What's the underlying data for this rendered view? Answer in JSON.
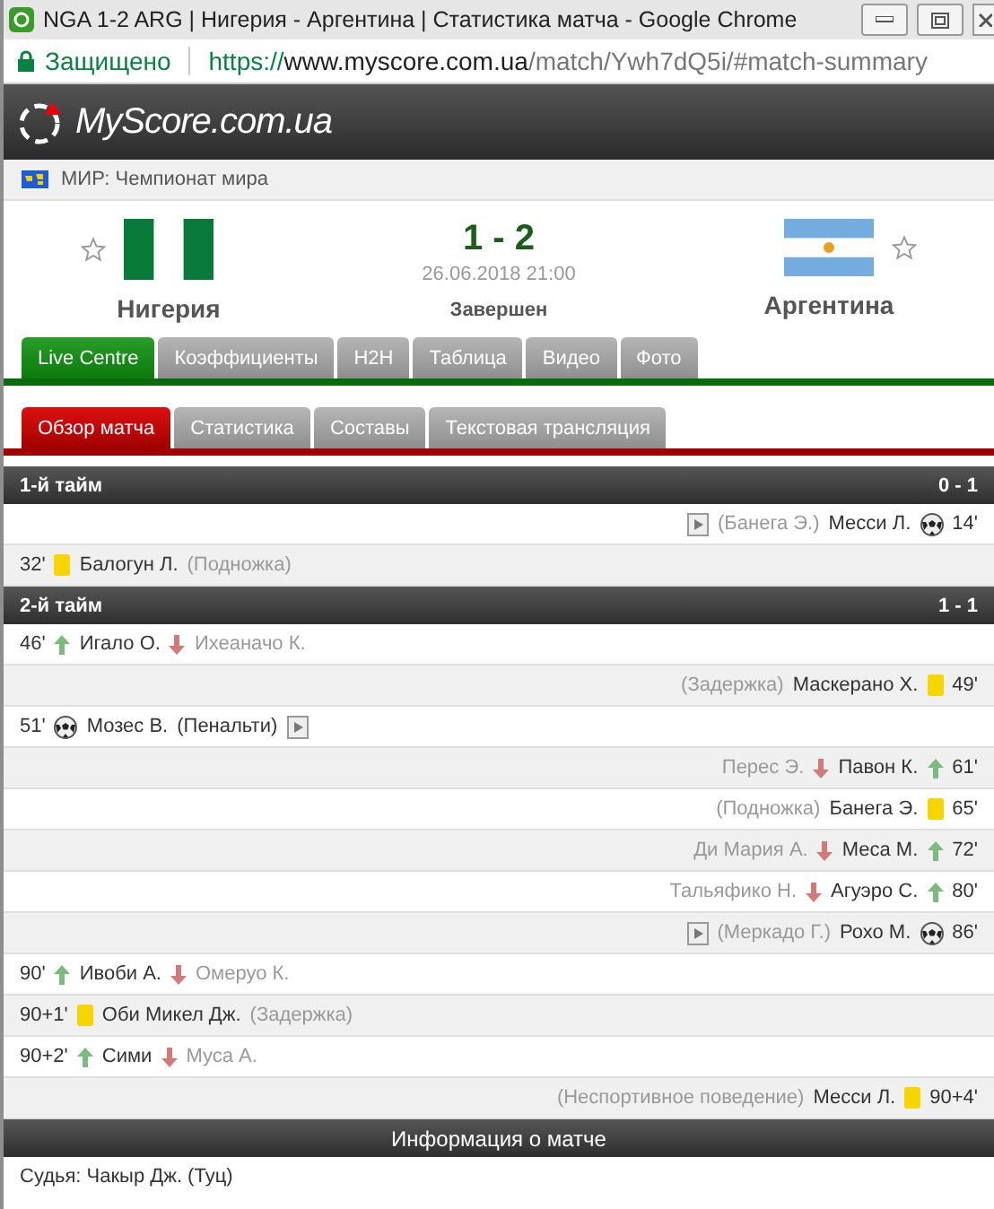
{
  "window": {
    "title": "NGA 1-2 ARG | Нигерия - Аргентина | Статистика матча - Google Chrome"
  },
  "address_bar": {
    "secure_label": "Защищено",
    "url_scheme": "https://",
    "url_host": "www.myscore.com.ua",
    "url_path": "/match/Ywh7dQ5i/#match-summary"
  },
  "site": {
    "logo": "MyScore.com.ua"
  },
  "competition": "МИР: Чемпионат мира",
  "match": {
    "home": "Нигерия",
    "away": "Аргентина",
    "score": "1 - 2",
    "date": "26.06.2018 21:00",
    "status": "Завершен",
    "home_favorite": false,
    "away_favorite": false
  },
  "tabs": [
    {
      "label": "Live Centre",
      "selected": true
    },
    {
      "label": "Коэффициенты",
      "selected": false
    },
    {
      "label": "H2H",
      "selected": false
    },
    {
      "label": "Таблица",
      "selected": false
    },
    {
      "label": "Видео",
      "selected": false
    },
    {
      "label": "Фото",
      "selected": false
    }
  ],
  "subtabs": [
    {
      "label": "Обзор матча",
      "selected": true
    },
    {
      "label": "Статистика",
      "selected": false
    },
    {
      "label": "Составы",
      "selected": false
    },
    {
      "label": "Текстовая трансляция",
      "selected": false
    }
  ],
  "periods": [
    {
      "title": "1-й тайм",
      "score": "0 - 1",
      "events": [
        {
          "away": true,
          "kind": "goal",
          "time": "14'",
          "player": "Месси Л.",
          "note": "(Банега Э.)",
          "note_muted": true,
          "video": true
        },
        {
          "away": false,
          "kind": "card",
          "time": "32'",
          "player": "Балогун Л.",
          "note": "(Подножка)",
          "note_muted": true,
          "video": false
        }
      ]
    },
    {
      "title": "2-й тайм",
      "score": "1 - 1",
      "events": [
        {
          "away": false,
          "kind": "sub",
          "time": "46'",
          "player": "Игало О.",
          "note": "Ихеаначо К.",
          "note_muted": true,
          "video": false
        },
        {
          "away": true,
          "kind": "card",
          "time": "49'",
          "player": "Маскерано Х.",
          "note": "(Задержка)",
          "note_muted": true,
          "video": false
        },
        {
          "away": false,
          "kind": "goal",
          "time": "51'",
          "player": "Мозес В.",
          "note": "(Пенальти)",
          "note_muted": false,
          "video": true
        },
        {
          "away": true,
          "kind": "sub",
          "time": "61'",
          "player": "Павон К.",
          "note": "Перес Э.",
          "note_muted": true,
          "video": false
        },
        {
          "away": true,
          "kind": "card",
          "time": "65'",
          "player": "Банега Э.",
          "note": "(Подножка)",
          "note_muted": true,
          "video": false
        },
        {
          "away": true,
          "kind": "sub",
          "time": "72'",
          "player": "Меса М.",
          "note": "Ди Мария А.",
          "note_muted": true,
          "video": false
        },
        {
          "away": true,
          "kind": "sub",
          "time": "80'",
          "player": "Агуэро С.",
          "note": "Тальяфико Н.",
          "note_muted": true,
          "video": false
        },
        {
          "away": true,
          "kind": "goal",
          "time": "86'",
          "player": "Рохо М.",
          "note": "(Меркадо Г.)",
          "note_muted": true,
          "video": true
        },
        {
          "away": false,
          "kind": "sub",
          "time": "90'",
          "player": "Ивоби А.",
          "note": "Омеруо К.",
          "note_muted": true,
          "video": false
        },
        {
          "away": false,
          "kind": "card",
          "time": "90+1'",
          "player": "Оби Микел Дж.",
          "note": "(Задержка)",
          "note_muted": true,
          "video": false
        },
        {
          "away": false,
          "kind": "sub",
          "time": "90+2'",
          "player": "Сими",
          "note": "Муса А.",
          "note_muted": true,
          "video": false
        },
        {
          "away": true,
          "kind": "card",
          "time": "90+4'",
          "player": "Месси Л.",
          "note": "(Неспортивное поведение)",
          "note_muted": true,
          "video": false
        }
      ]
    }
  ],
  "info": {
    "title": "Информация о матче",
    "referee": "Судья: Чакыр Дж. (Туц)"
  }
}
